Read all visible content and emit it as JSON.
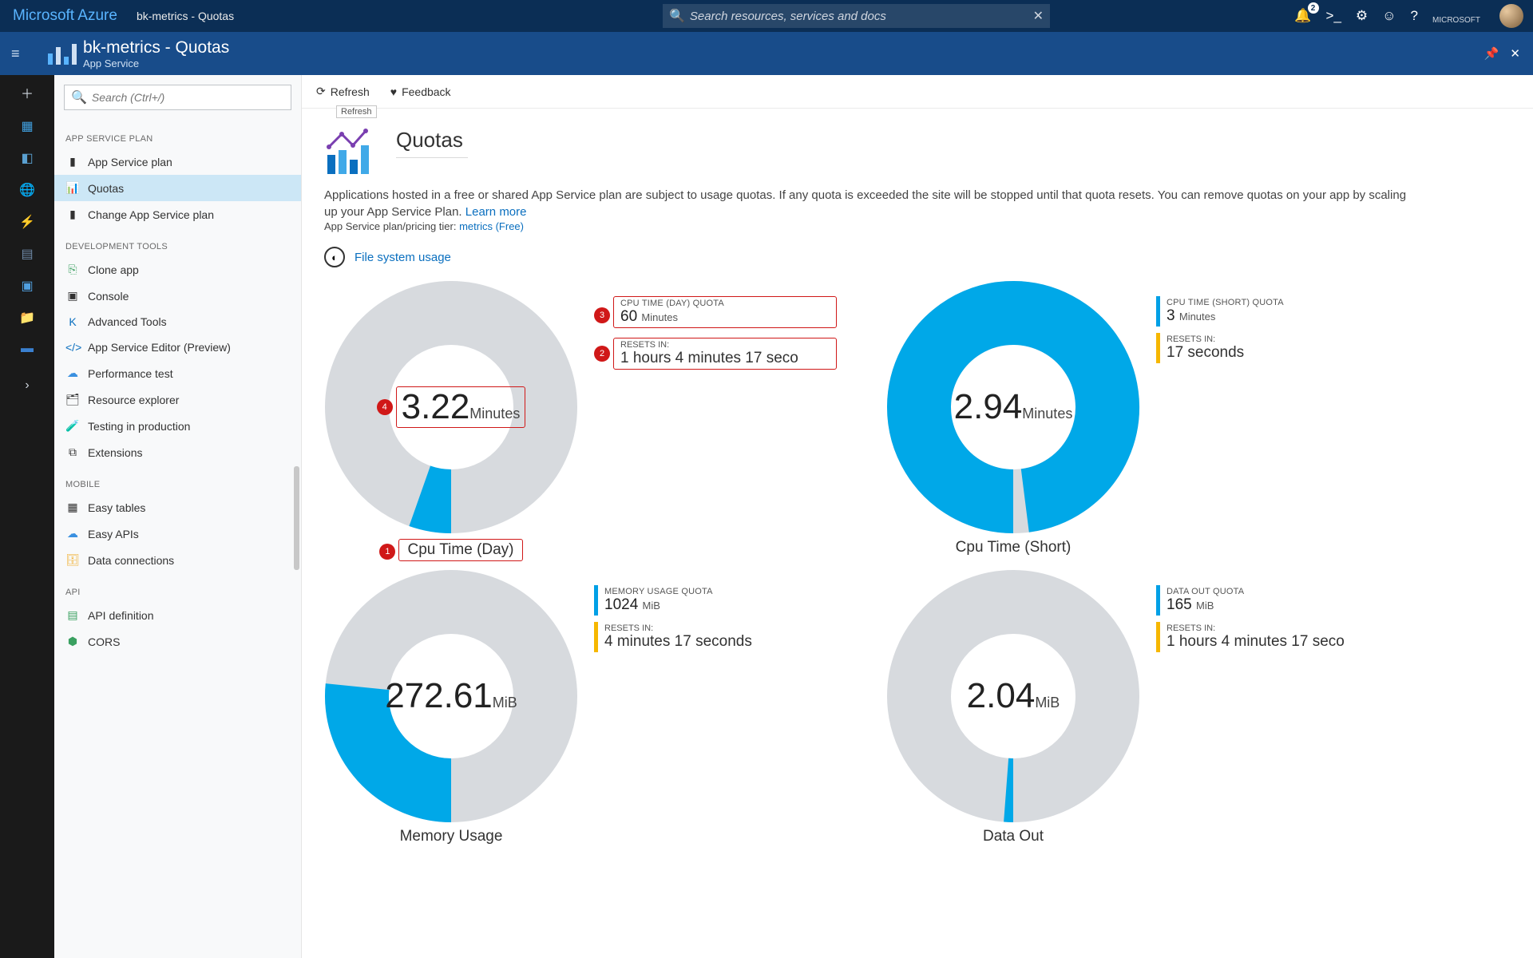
{
  "brand": "Microsoft Azure",
  "breadcrumb": "bk-metrics - Quotas",
  "search_placeholder": "Search resources, services and docs",
  "notif_count": "2",
  "account_label": "MICROSOFT",
  "subheader": {
    "title": "bk-metrics - Quotas",
    "subtitle": "App Service"
  },
  "nav_search_placeholder": "Search (Ctrl+/)",
  "nav": {
    "group1": "APP SERVICE PLAN",
    "items1": [
      "App Service plan",
      "Quotas",
      "Change App Service plan"
    ],
    "group2": "DEVELOPMENT TOOLS",
    "items2": [
      "Clone app",
      "Console",
      "Advanced Tools",
      "App Service Editor (Preview)",
      "Performance test",
      "Resource explorer",
      "Testing in production",
      "Extensions"
    ],
    "group3": "MOBILE",
    "items3": [
      "Easy tables",
      "Easy APIs",
      "Data connections"
    ],
    "group4": "API",
    "items4": [
      "API definition",
      "CORS"
    ]
  },
  "cmds": {
    "refresh": "Refresh",
    "feedback": "Feedback",
    "tooltip": "Refresh"
  },
  "page": {
    "title": "Quotas",
    "desc_pre": "Applications hosted in a free or shared App Service plan are subject to usage quotas. If any quota is exceeded the site will be stopped until that quota resets. You can remove quotas on your app by scaling up your App Service Plan. ",
    "learn_more": "Learn more",
    "tier_pre": "App Service plan/pricing tier: ",
    "tier_link": "metrics (Free)",
    "fs_link": "File system usage"
  },
  "quotas": [
    {
      "name": "Cpu Time (Day)",
      "value": "3.22",
      "unit": "Minutes",
      "percent": 5.4,
      "quota_label": "CPU TIME (DAY) QUOTA",
      "quota": "60",
      "quota_unit": "Minutes",
      "resets": "1 hours 4 minutes 17 seco"
    },
    {
      "name": "Cpu Time (Short)",
      "value": "2.94",
      "unit": "Minutes",
      "percent": 98,
      "quota_label": "CPU TIME (SHORT) QUOTA",
      "quota": "3",
      "quota_unit": "Minutes",
      "resets": "17 seconds"
    },
    {
      "name": "Memory Usage",
      "value": "272.61",
      "unit": "MiB",
      "percent": 26.6,
      "quota_label": "MEMORY USAGE QUOTA",
      "quota": "1024",
      "quota_unit": "MiB",
      "resets": "4 minutes 17 seconds"
    },
    {
      "name": "Data Out",
      "value": "2.04",
      "unit": "MiB",
      "percent": 1.2,
      "quota_label": "DATA OUT QUOTA",
      "quota": "165",
      "quota_unit": "MiB",
      "resets": "1 hours 4 minutes 17 seco"
    }
  ],
  "annotations": [
    "1",
    "2",
    "3",
    "4"
  ],
  "chart_data": [
    {
      "type": "pie",
      "title": "Cpu Time (Day)",
      "series": [
        {
          "name": "used",
          "values": [
            3.22
          ]
        },
        {
          "name": "remaining",
          "values": [
            56.78
          ]
        }
      ],
      "unit": "Minutes"
    },
    {
      "type": "pie",
      "title": "Cpu Time (Short)",
      "series": [
        {
          "name": "used",
          "values": [
            2.94
          ]
        },
        {
          "name": "remaining",
          "values": [
            0.06
          ]
        }
      ],
      "unit": "Minutes"
    },
    {
      "type": "pie",
      "title": "Memory Usage",
      "series": [
        {
          "name": "used",
          "values": [
            272.61
          ]
        },
        {
          "name": "remaining",
          "values": [
            751.39
          ]
        }
      ],
      "unit": "MiB"
    },
    {
      "type": "pie",
      "title": "Data Out",
      "series": [
        {
          "name": "used",
          "values": [
            2.04
          ]
        },
        {
          "name": "remaining",
          "values": [
            162.96
          ]
        }
      ],
      "unit": "MiB"
    }
  ]
}
